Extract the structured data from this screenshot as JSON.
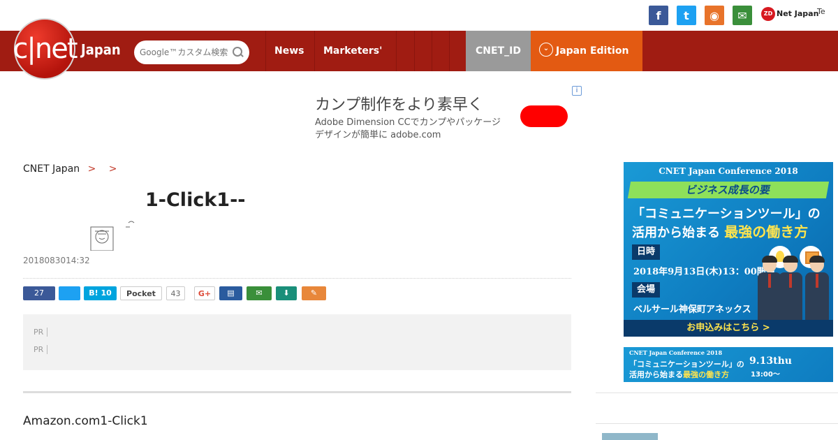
{
  "social": {
    "facebook_glyph": "f",
    "twitter_glyph": "t",
    "rss_glyph": "◉",
    "mail_glyph": "✉",
    "zdnet_badge": "ZD",
    "zdnet_label": "Net Japan",
    "te_label": "Te"
  },
  "header": {
    "logo_text": "c|net",
    "logo_japan": "Japan",
    "search_placeholder": "Google™カスタム検索",
    "nav": [
      "News",
      "Marketers'",
      "",
      "",
      "",
      ""
    ],
    "cnet_id": "CNET_ID",
    "edition": "Japan Edition",
    "edition_glyph": "⌄"
  },
  "ad": {
    "info": "i",
    "headline": "カンプ制作をより素早く",
    "line1": "Adobe Dimension CCでカンプやパッケージ",
    "line2": "デザインが簡単に adobe.com"
  },
  "breadcrumb": {
    "home": "CNET Japan",
    "sep": ">",
    "level2": "",
    "level3": ""
  },
  "article": {
    "headline": "1-Click1--",
    "byline": "2018083014:32",
    "body": "Amazon.com1-Click1"
  },
  "share": {
    "facebook": "27",
    "twitter": "",
    "hatena": "B! 10",
    "pocket": "Pocket",
    "pocket_count": "43",
    "gplus": "G+",
    "print": "▤",
    "mail": "✉",
    "download": "⬇",
    "clip": "✎"
  },
  "pr": {
    "label": "PR",
    "items": [
      "",
      ""
    ]
  },
  "sidebar": {
    "banner1": {
      "top": "CNET Japan Conference 2018",
      "green": "ビジネス成長の要",
      "line1": "「コミュニケーションツール」の",
      "line2a": "活用から始まる",
      "line2b": "最強の働き方",
      "label1": "日時",
      "date": "2018年9月13日(木)13：00開演",
      "label2": "会場",
      "venue": "ベルサール神保町アネックス",
      "cta": "お申込みはこちら >"
    },
    "banner2": {
      "top": "CNET Japan Conference 2018",
      "line1": "「コミュニケーションツール」の",
      "line2a": "活用から始まる",
      "line2b": "最強の働き方",
      "date": "9.13thu",
      "time": "13:00〜"
    },
    "heading": "",
    "first_item": ""
  },
  "colors": {
    "header_red": "#a01c12",
    "edition_orange": "#e35a12",
    "cnet_id_gray": "#9a9a9a"
  }
}
